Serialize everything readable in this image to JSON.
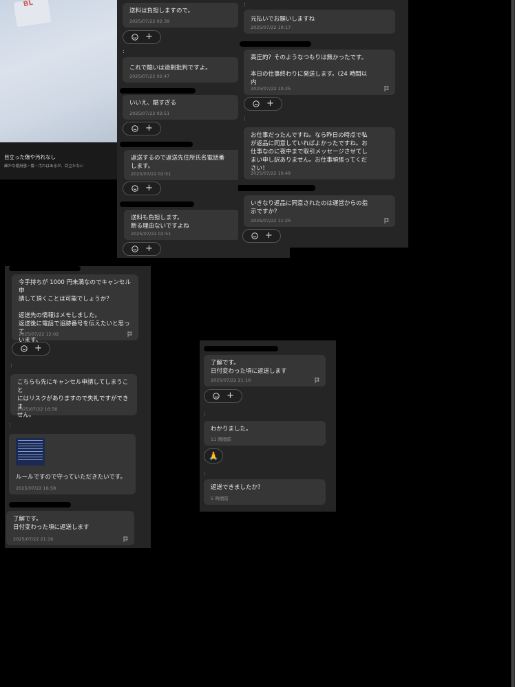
{
  "product": {
    "caption_title": "目立った傷や汚れなし",
    "caption_sub": "細かな使用感・傷・汚れはあるが、目立たない"
  },
  "panelA": {
    "messages": [
      {
        "text": "送料は負担しますので。",
        "time": "2025/07/22 02:39"
      },
      {
        "text": "これで酷いは過剰批判ですよ。",
        "time": "2025/07/22 02:47"
      },
      {
        "text": "いいえ、酷すぎる",
        "time": "2025/07/22 02:51"
      },
      {
        "text": "返送するので返送先住所氏名電話番\nします。",
        "time": "2025/07/22 02:51"
      },
      {
        "text": "送料も負担します。\n断る理由ないですよね",
        "time": "2025/07/22 02:51"
      }
    ]
  },
  "panelB": {
    "messages": [
      {
        "text": "元払いでお願いしますね",
        "time": "2025/07/22 10:17"
      },
      {
        "text": "高圧的？そのようなつもりは無かったです。\n\n本日の仕事終わりに発送します。(24 時間以\n内",
        "time": "2025/07/22 10:25"
      },
      {
        "text": "お仕事だったんですね。なら昨日の時点で私\nが返品に同意していればよかったですね。お\n仕事なのに夜中まで取引メッセージさせてし\nまい申し訳ありません。お仕事頑張ってくだ\nさい！",
        "time": "2025/07/22 10:49"
      },
      {
        "text": "いきなり返品に同意されたのは運営からの指\n示ですか？",
        "time": "2025/07/22 11:25"
      }
    ]
  },
  "panelC": {
    "messages": [
      {
        "text": "今手持ちが 1000 円未満なのでキャンセル申\n請して頂くことは可能でしょうか？\n\n返送先の情報はメモしました。\n返送後に電話で追跡番号を伝えたいと思って\nいます。",
        "time": "2025/07/22 12:02"
      },
      {
        "text": "こちらも先にキャンセル申請してしまうこと\nにはリスクがありますので失礼ですができま\nせん。",
        "time": "2025/07/22 16:58"
      },
      {
        "text": "ルールですので守っていただきたいです。",
        "time": "2025/07/22 16:58"
      },
      {
        "text": "了解です。\n日付変わった頃に返送します",
        "time": "2025/07/22 21:16"
      }
    ]
  },
  "panelD": {
    "messages": [
      {
        "text": "了解です。\n日付変わった頃に返送します",
        "time": "2025/07/22 21:16"
      },
      {
        "text": "わかりました。",
        "time": "11 時間前"
      },
      {
        "text": "返送できましたか？",
        "time": "5 時間前"
      }
    ],
    "reaction_emoji": "🙏"
  },
  "ui": {
    "plus": "+",
    "dot": ":",
    "logo": "BL"
  }
}
